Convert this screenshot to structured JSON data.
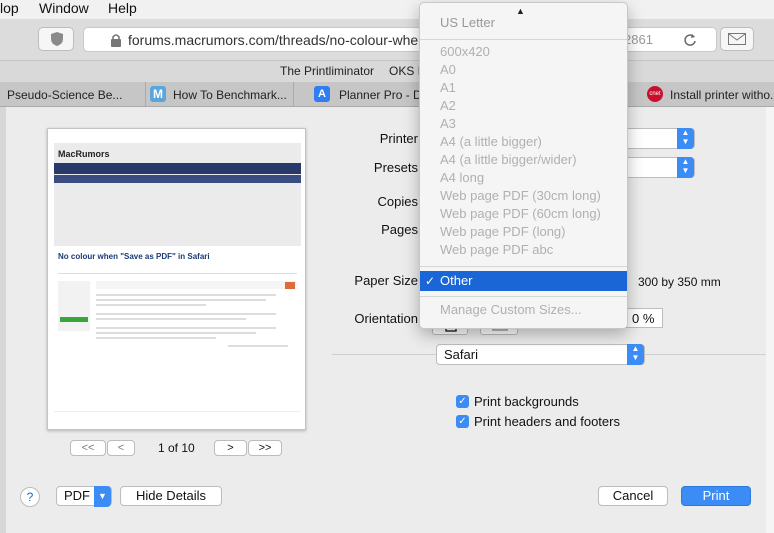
{
  "menubar": {
    "items": [
      "lop",
      "Window",
      "Help"
    ]
  },
  "toolbar": {
    "address": "forums.macrumors.com/threads/no-colour-when-sa",
    "address_tail": "2861",
    "icons": [
      "shield-icon",
      "lock-icon",
      "reload-icon",
      "mail-icon"
    ]
  },
  "bookmarks": {
    "items": [
      "The Printliminator",
      "OKS I"
    ]
  },
  "tabs": [
    {
      "label": "Pseudo-Science Be...",
      "icon": ""
    },
    {
      "label": "How To Benchmark...",
      "icon": "M"
    },
    {
      "label": "Planner Pro - Da",
      "icon": "A"
    },
    {
      "label": "Install printer witho...",
      "icon": "cnet"
    }
  ],
  "preview": {
    "site_name": "MacRumors",
    "page_title": "No colour when \"Save as PDF\" in Safari",
    "page_counter": "1 of 10",
    "nav_first": "<<",
    "nav_prev": "<",
    "nav_next": ">",
    "nav_last": ">>"
  },
  "form": {
    "printer_label": "Printer",
    "presets_label": "Presets",
    "copies_label": "Copies",
    "pages_label": "Pages",
    "paper_size_label": "Paper Size",
    "paper_size_dims": "300 by 350 mm",
    "orientation_label": "Orientation",
    "scale_value": "0 %",
    "section_select": "Safari"
  },
  "checkboxes": [
    {
      "label": "Print backgrounds",
      "checked": true
    },
    {
      "label": "Print headers and footers",
      "checked": true
    }
  ],
  "buttons": {
    "help": "?",
    "pdf": "PDF",
    "hide_details": "Hide Details",
    "cancel": "Cancel",
    "print": "Print"
  },
  "dropdown": {
    "top_item": "US Letter",
    "items": [
      "600x420",
      "A0",
      "A1",
      "A2",
      "A3",
      "A4 (a little bigger)",
      "A4 (a little bigger/wider)",
      "A4 long",
      "Web page PDF (30cm long)",
      "Web page PDF (60cm long)",
      "Web page PDF (long)",
      "Web page PDF abc"
    ],
    "selected": "Other",
    "manage": "Manage Custom Sizes..."
  },
  "colors": {
    "accent": "#3b8cf5",
    "selection": "#1b66d6"
  }
}
